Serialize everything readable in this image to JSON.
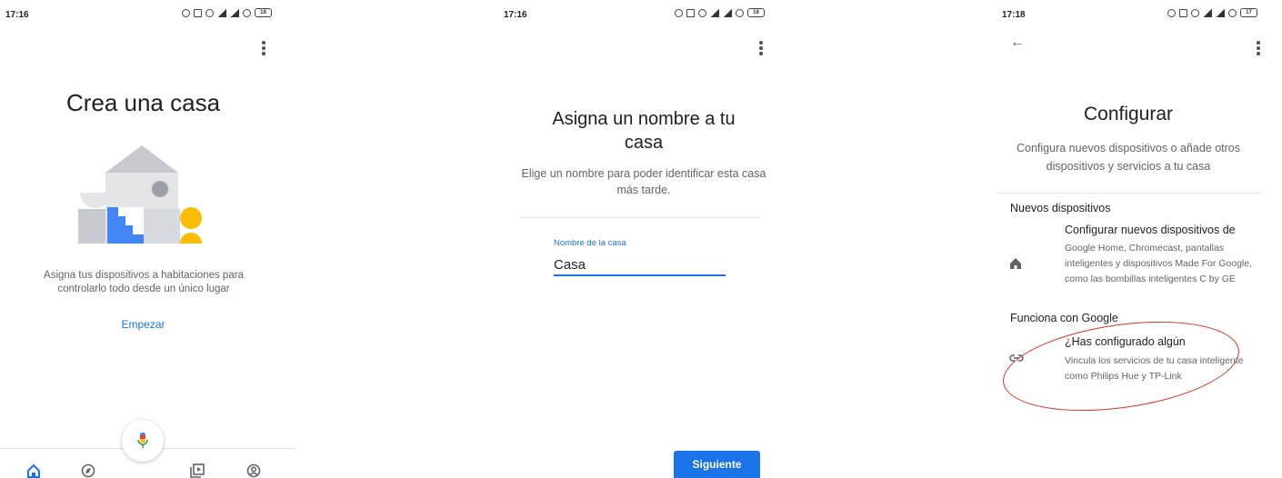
{
  "screen1": {
    "status_time": "17:16",
    "battery": "18",
    "title": "Crea una casa",
    "description": "Asigna tus dispositivos a habitaciones para controlarlo todo desde un único lugar",
    "start_link": "Empezar",
    "nav_icons": [
      "home-icon",
      "explore-icon",
      "mic-icon",
      "media-icon",
      "account-icon"
    ]
  },
  "screen2": {
    "status_time": "17:16",
    "battery": "18",
    "title": "Asigna un nombre a tu casa",
    "description": "Elige un nombre para poder identificar esta casa más tarde.",
    "field_label": "Nombre de la casa",
    "field_value": "Casa",
    "next_button": "Siguiente"
  },
  "screen3": {
    "status_time": "17:18",
    "battery": "17",
    "title": "Configurar",
    "subtitle": "Configura nuevos dispositivos o añade otros dispositivos y servicios a tu casa",
    "section_new": "Nuevos dispositivos",
    "new_item_title": "Configurar nuevos dispositivos de",
    "new_item_desc": "Google Home, Chromecast, pantallas inteligentes y dispositivos Made For Google, como las bombillas inteligentes C by GE",
    "section_works": "Funciona con Google",
    "works_item_title": "¿Has configurado algún",
    "works_item_desc": "Vincula los servicios de tu casa inteligente como Philips Hue y TP-Link"
  },
  "colors": {
    "accent": "#1a73e8",
    "annotation": "#d93025"
  }
}
